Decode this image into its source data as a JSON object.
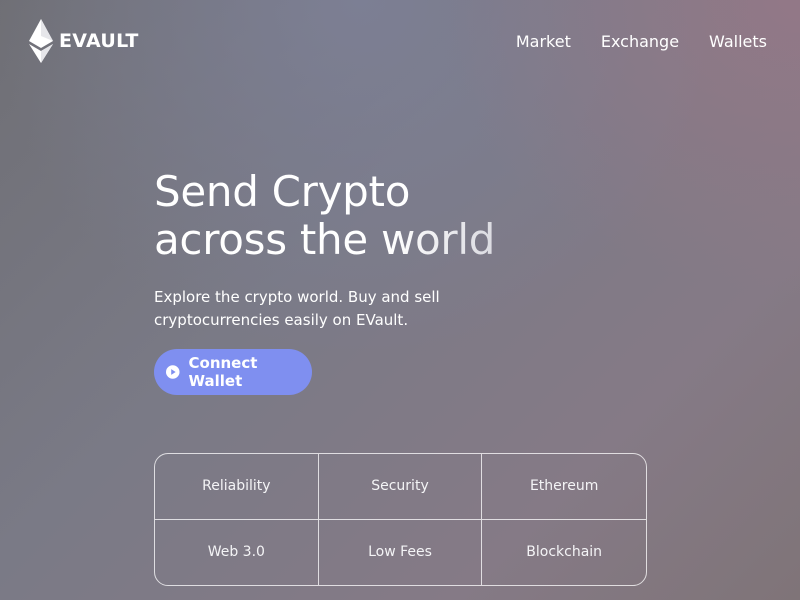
{
  "brand": {
    "name": "EVAULT",
    "logo_icon": "ethereum-diamond-icon"
  },
  "nav": {
    "links": [
      "Market",
      "Exchange",
      "Wallets"
    ]
  },
  "hero": {
    "title_line1": "Send Crypto",
    "title_line2": "across the world",
    "subtitle": "Explore the crypto world. Buy and sell cryptocurrencies easily on EVault.",
    "cta_label": "Connect Wallet",
    "cta_icon": "play-circle-icon"
  },
  "features": [
    "Reliability",
    "Security",
    "Ethereum",
    "Web 3.0",
    "Low Fees",
    "Blockchain"
  ],
  "colors": {
    "cta_background": "#7f8ff0",
    "text": "#ffffff",
    "background": "#78787f"
  }
}
